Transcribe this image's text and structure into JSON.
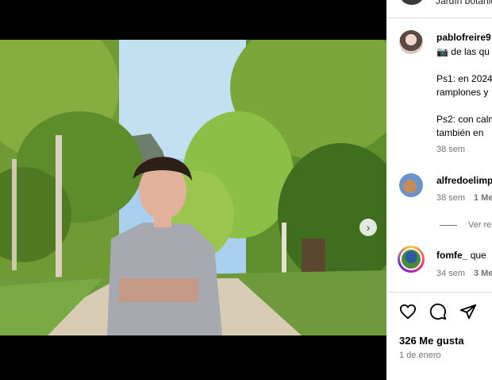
{
  "top": {
    "subtitle": "Jardín botánico"
  },
  "media": {
    "dots_total": 7,
    "dots_active": 0,
    "next_icon": "›",
    "photo_alt": ""
  },
  "caption": {
    "username": "pablofreire9",
    "line1": "📷 de las qu",
    "ps1_a": "Ps1: en 2024",
    "ps1_b": "ramplones y",
    "ps2_a": "Ps2: con calm",
    "ps2_b": "también en",
    "time": "38 sem"
  },
  "comments": [
    {
      "username": "alfredoelimp",
      "text": "",
      "time": "38 sem",
      "likes": "1 Me"
    },
    {
      "username": "fomfe_",
      "text": "que",
      "time": "34 sem",
      "likes": "3 Me"
    }
  ],
  "view_replies": "Ver re",
  "actions": {
    "like_icon": "heart-icon",
    "comment_icon": "comment-icon",
    "share_icon": "send-icon"
  },
  "likes": "326 Me gusta",
  "date": "1 de enero"
}
